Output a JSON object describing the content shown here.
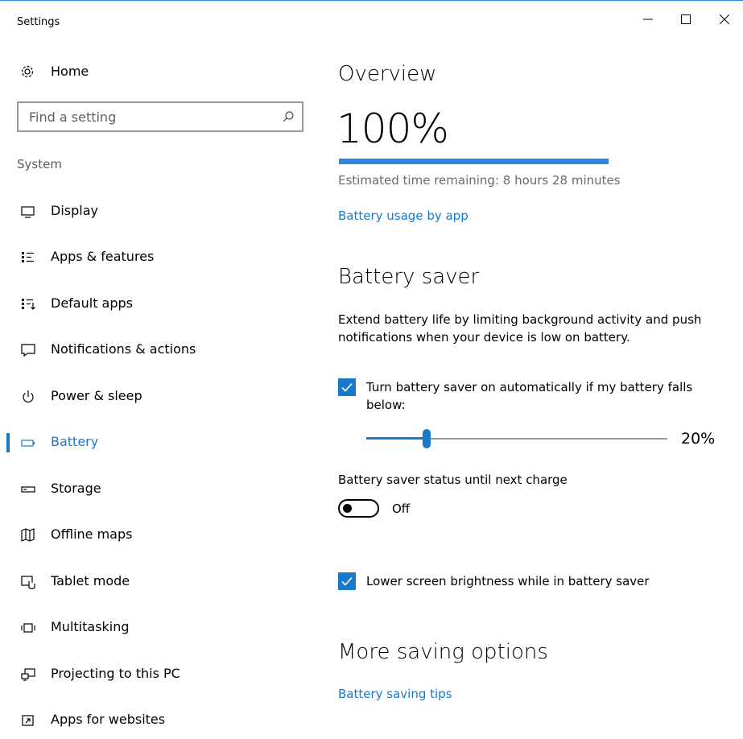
{
  "window": {
    "title": "Settings",
    "minimize_glyph": "—",
    "maximize_glyph": "☐",
    "close_glyph": "✕"
  },
  "sidebar": {
    "home_label": "Home",
    "search": {
      "placeholder": "Find a setting"
    },
    "section_label": "System",
    "active_item": "Battery",
    "items": [
      {
        "label": "Display",
        "icon": "monitor-icon"
      },
      {
        "label": "Apps & features",
        "icon": "apps-list-icon"
      },
      {
        "label": "Default apps",
        "icon": "default-apps-icon"
      },
      {
        "label": "Notifications & actions",
        "icon": "notification-icon"
      },
      {
        "label": "Power & sleep",
        "icon": "power-icon"
      },
      {
        "label": "Battery",
        "icon": "battery-icon"
      },
      {
        "label": "Storage",
        "icon": "storage-icon"
      },
      {
        "label": "Offline maps",
        "icon": "map-icon"
      },
      {
        "label": "Tablet mode",
        "icon": "tablet-mode-icon"
      },
      {
        "label": "Multitasking",
        "icon": "multitasking-icon"
      },
      {
        "label": "Projecting to this PC",
        "icon": "projecting-icon"
      },
      {
        "label": "Apps for websites",
        "icon": "apps-websites-icon"
      }
    ]
  },
  "main": {
    "overview": {
      "heading": "Overview",
      "charge_text": "100%",
      "charge_fraction": 1.0,
      "estimated_time": "Estimated time remaining: 8 hours 28 minutes",
      "usage_link": "Battery usage by app"
    },
    "battery_saver": {
      "heading": "Battery saver",
      "description": "Extend battery life by limiting background activity and push notifications when your device is low on battery.",
      "auto_checkbox_label": "Turn battery saver on automatically if my battery falls below:",
      "auto_checked": true,
      "threshold_value": "20%",
      "threshold_fraction": 0.2,
      "status_label": "Battery saver status until next charge",
      "status_toggle_text": "Off",
      "status_on": false,
      "brightness_checkbox_label": "Lower screen brightness while in battery saver",
      "brightness_checked": true
    },
    "more_options": {
      "heading": "More saving options",
      "tips_link": "Battery saving tips"
    }
  },
  "colors": {
    "accent": "#1979ca",
    "bar": "#2b88d8",
    "muted_text": "#6b6b6b"
  }
}
